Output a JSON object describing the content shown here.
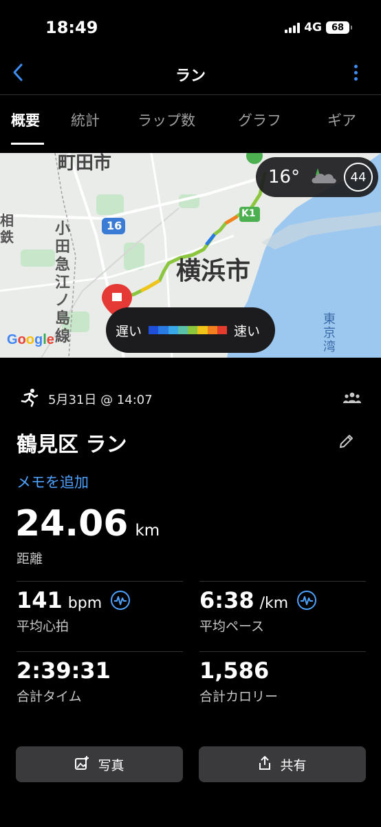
{
  "status_bar": {
    "time": "18:49",
    "network": "4G",
    "battery": "68"
  },
  "nav": {
    "title": "ラン",
    "back_icon": "chevron-left-icon",
    "more_icon": "vertical-ellipsis-icon",
    "accent": "#3e8ef7"
  },
  "tabs": [
    {
      "label": "概要",
      "active": true
    },
    {
      "label": "統計",
      "active": false
    },
    {
      "label": "ラップ数",
      "active": false
    },
    {
      "label": "グラフ",
      "active": false
    },
    {
      "label": "ギア",
      "active": false
    }
  ],
  "map": {
    "labels": {
      "machida": "町田市",
      "odakyu": "小田急江ノ島線",
      "sagami": "相鉄",
      "route16": "16",
      "k1": "K1",
      "yokohama": "横浜市",
      "tokyo_bay": "東京湾"
    },
    "brand": "Google",
    "weather": {
      "temperature": "16°",
      "aqi": "44",
      "icon": "cloudy-night-icon"
    },
    "legend": {
      "slow": "遅い",
      "fast": "速い",
      "colors": [
        "#1f4fd8",
        "#2a7ae4",
        "#39a7e8",
        "#5bc0a8",
        "#8cc63f",
        "#f0c419",
        "#f2801e",
        "#e33b2e"
      ]
    }
  },
  "activity": {
    "date": "5月31日 @ 14:07",
    "title": "鶴見区 ラン",
    "add_memo": "メモを追加",
    "distance": {
      "value": "24.06",
      "unit": "km",
      "label": "距離"
    },
    "stats": {
      "heart_rate": {
        "value": "141",
        "unit": "bpm",
        "label": "平均心拍"
      },
      "pace": {
        "value": "6:38",
        "unit": "/km",
        "label": "平均ペース"
      },
      "time": {
        "value": "2:39:31",
        "label": "合計タイム"
      },
      "calories": {
        "value": "1,586",
        "label": "合計カロリー"
      }
    }
  },
  "buttons": {
    "photo": "写真",
    "share": "共有"
  }
}
